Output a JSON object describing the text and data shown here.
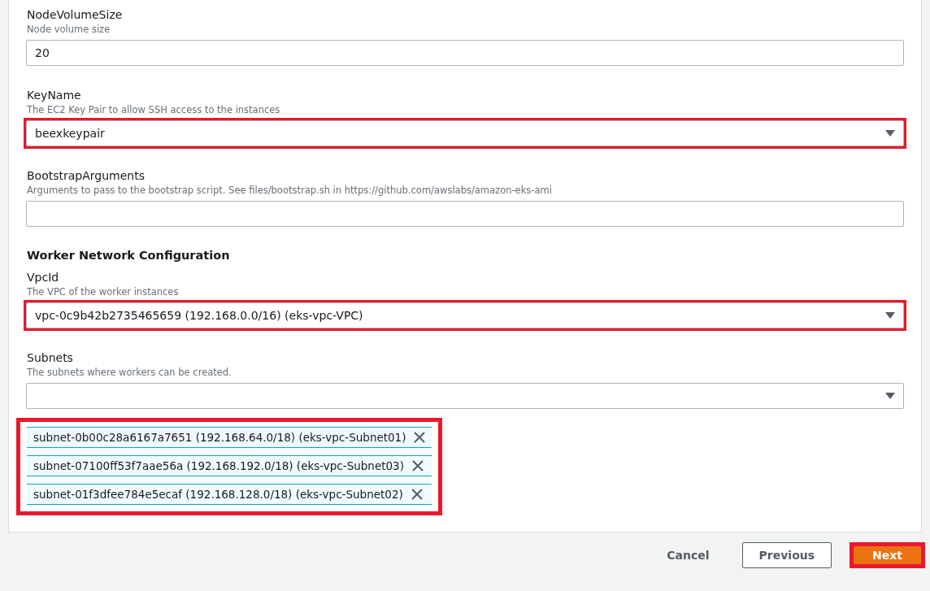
{
  "sections": [
    {
      "fields": [
        {
          "kind": "text",
          "label": "NodeVolumeSize",
          "description": "Node volume size",
          "value": "20",
          "highlighted": false
        },
        {
          "kind": "select",
          "label": "KeyName",
          "description": "The EC2 Key Pair to allow SSH access to the instances",
          "value": "beexkeypair",
          "highlighted": true
        },
        {
          "kind": "text",
          "label": "BootstrapArguments",
          "description": "Arguments to pass to the bootstrap script. See files/bootstrap.sh in https://github.com/awslabs/amazon-eks-ami",
          "highlighted": false
        }
      ]
    },
    {
      "heading": "Worker Network Configuration",
      "fields": [
        {
          "kind": "select",
          "label": "VpcId",
          "description": "The VPC of the worker instances",
          "value": "vpc-0c9b42b2735465659 (192.168.0.0/16) (eks-vpc-VPC)",
          "highlighted": true
        },
        {
          "kind": "select",
          "label": "Subnets",
          "description": "The subnets where workers can be created.",
          "highlighted": false,
          "tokens_highlighted": true,
          "tokens": [
            "subnet-0b00c28a6167a7651 (192.168.64.0/18) (eks-vpc-Subnet01)",
            "subnet-07100ff53f7aae56a (192.168.192.0/18) (eks-vpc-Subnet03)",
            "subnet-01f3dfee784e5ecaf (192.168.128.0/18) (eks-vpc-Subnet02)"
          ]
        }
      ]
    }
  ],
  "buttons": [
    {
      "kind": "link",
      "label": "Cancel",
      "highlighted": false
    },
    {
      "kind": "secondary",
      "label": "Previous",
      "highlighted": false
    },
    {
      "kind": "primary",
      "label": "Next",
      "highlighted": true
    }
  ]
}
